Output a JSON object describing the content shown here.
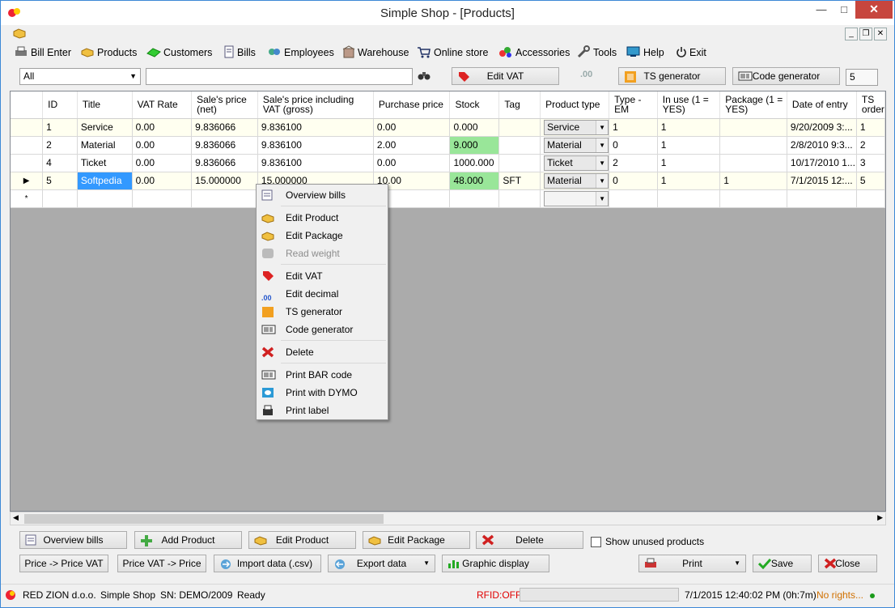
{
  "window": {
    "title": "Simple Shop - [Products]",
    "close_glyph": "✕",
    "min_glyph": "—",
    "max_glyph": "□"
  },
  "menu": [
    {
      "label": "Bill Enter",
      "icon": "printer-icon"
    },
    {
      "label": "Products",
      "icon": "products-icon"
    },
    {
      "label": "Customers",
      "icon": "customers-icon"
    },
    {
      "label": "Bills",
      "icon": "bills-icon"
    },
    {
      "label": "Employees",
      "icon": "employees-icon"
    },
    {
      "label": "Warehouse",
      "icon": "warehouse-icon"
    },
    {
      "label": "Online store",
      "icon": "cart-icon"
    },
    {
      "label": "Accessories",
      "icon": "accessories-icon"
    },
    {
      "label": "Tools",
      "icon": "tools-icon"
    },
    {
      "label": "Help",
      "icon": "help-icon"
    },
    {
      "label": "Exit",
      "icon": "power-icon"
    }
  ],
  "toolbar": {
    "filter_value": "All",
    "search_value": "",
    "edit_vat": "Edit VAT",
    "ts_generator": "TS generator",
    "code_generator": "Code generator",
    "quantity": "5"
  },
  "grid": {
    "columns": [
      "ID",
      "Title",
      "VAT Rate",
      "Sale's price (net)",
      "Sale's price including VAT (gross)",
      "Purchase price",
      "Stock",
      "Tag",
      "Product type",
      "Type - EM",
      "In use (1 = YES)",
      "Package (1 = YES)",
      "Date of entry",
      "TS order"
    ],
    "rows": [
      {
        "id": "1",
        "title": "Service",
        "vat": "0.00",
        "net": "9.836066",
        "gross": "9.836100",
        "purchase": "0.00",
        "stock": "0.000",
        "tag": "",
        "type": "Service",
        "em": "1",
        "in_use": "1",
        "package": "",
        "date": "9/20/2009 3:...",
        "ts": "1"
      },
      {
        "id": "2",
        "title": "Material",
        "vat": "0.00",
        "net": "9.836066",
        "gross": "9.836100",
        "purchase": "2.00",
        "stock": "9.000",
        "tag": "",
        "type": "Material",
        "em": "0",
        "in_use": "1",
        "package": "",
        "date": "2/8/2010 9:3...",
        "ts": "2"
      },
      {
        "id": "4",
        "title": "Ticket",
        "vat": "0.00",
        "net": "9.836066",
        "gross": "9.836100",
        "purchase": "0.00",
        "stock": "1000.000",
        "tag": "",
        "type": "Ticket",
        "em": "2",
        "in_use": "1",
        "package": "",
        "date": "10/17/2010 1...",
        "ts": "3"
      },
      {
        "id": "5",
        "title": "Softpedia",
        "vat": "0.00",
        "net": "15.000000",
        "gross": "15.000000",
        "purchase": "10.00",
        "stock": "48.000",
        "tag": "SFT",
        "type": "Material",
        "em": "0",
        "in_use": "1",
        "package": "1",
        "date": "7/1/2015 12:...",
        "ts": "5"
      }
    ],
    "new_row_marker": "*",
    "current_row_marker": "▶",
    "stock_highlight_color": "#99e699",
    "selection_color": "#3399ff"
  },
  "context_menu": {
    "items": [
      {
        "label": "Overview bills",
        "icon": "overview-bills-icon",
        "enabled": true
      },
      {
        "label": "Edit Product",
        "icon": "edit-product-icon",
        "enabled": true
      },
      {
        "label": "Edit Package",
        "icon": "edit-package-icon",
        "enabled": true
      },
      {
        "label": "Read weight",
        "icon": "scale-icon",
        "enabled": false
      },
      {
        "label": "Edit VAT",
        "icon": "vat-tag-icon",
        "enabled": true
      },
      {
        "label": "Edit decimal",
        "icon": "decimal-icon",
        "enabled": true
      },
      {
        "label": "TS generator",
        "icon": "ts-generator-icon",
        "enabled": true
      },
      {
        "label": "Code generator",
        "icon": "barcode-icon",
        "enabled": true
      },
      {
        "label": "Delete",
        "icon": "delete-icon",
        "enabled": true
      },
      {
        "label": "Print BAR code",
        "icon": "barcode-print-icon",
        "enabled": true
      },
      {
        "label": "Print with DYMO",
        "icon": "dymo-icon",
        "enabled": true
      },
      {
        "label": "Print label",
        "icon": "label-printer-icon",
        "enabled": true
      }
    ]
  },
  "bottom": {
    "overview_bills": "Overview bills",
    "add_product": "Add Product",
    "edit_product": "Edit Product",
    "edit_package": "Edit Package",
    "delete": "Delete",
    "show_unused": "Show unused products",
    "price_to_vat": "Price -> Price VAT",
    "vat_to_price": "Price VAT -> Price",
    "import": "Import data (.csv)",
    "export": "Export data",
    "graphic": "Graphic display",
    "print": "Print",
    "save": "Save",
    "close": "Close"
  },
  "status": {
    "company": "RED ZION d.o.o.",
    "app": "Simple Shop",
    "sn": "SN:  DEMO/2009",
    "state": "Ready",
    "rfid": "RFID:OFF",
    "datetime": "7/1/2015 12:40:02 PM (0h:7m)",
    "rights": "No rights...",
    "rfid_color": "#e00000",
    "rights_color": "#d07000"
  }
}
